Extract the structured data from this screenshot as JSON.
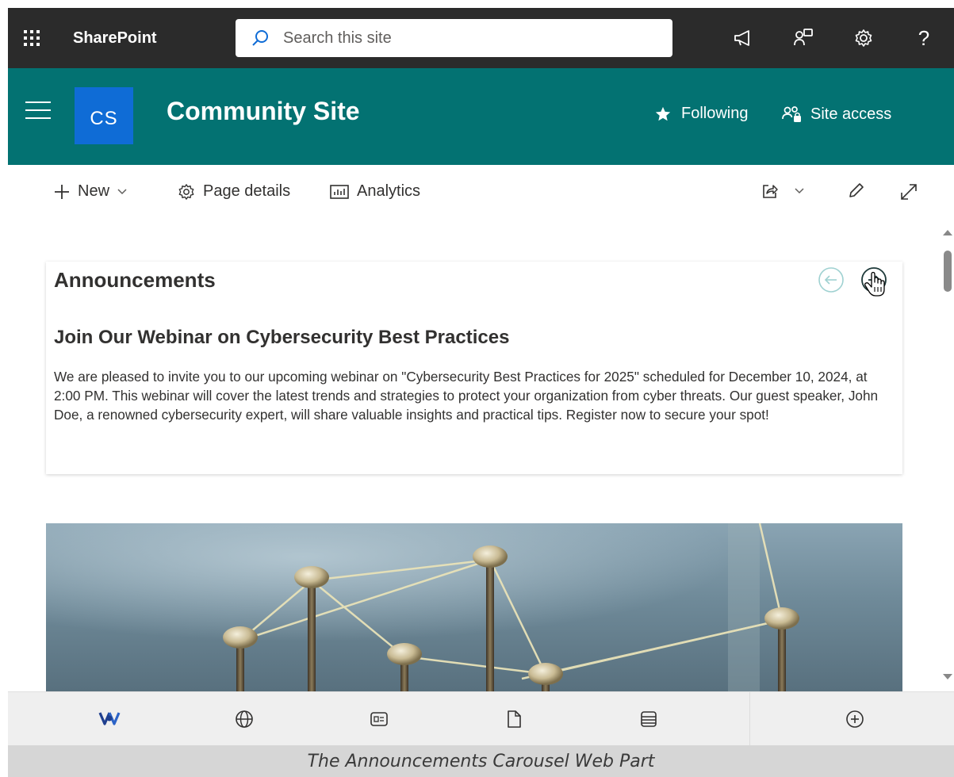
{
  "suitebar": {
    "app_name": "SharePoint",
    "search_placeholder": "Search this site",
    "help_label": "?"
  },
  "site": {
    "logo_text": "CS",
    "title": "Community Site",
    "following_label": "Following",
    "site_access_label": "Site access",
    "colors": {
      "header_bg": "#037272",
      "logo_bg": "#0f6cd6",
      "suitebar_bg": "#2b2b2b"
    }
  },
  "commandbar": {
    "new_label": "New",
    "page_details_label": "Page details",
    "analytics_label": "Analytics"
  },
  "announcements": {
    "title": "Announcements",
    "item": {
      "heading": "Join Our Webinar on Cybersecurity Best Practices",
      "body": "We are pleased to invite you to our upcoming webinar on \"Cybersecurity Best Practices for 2025\" scheduled for December 10, 2024, at 2:00 PM. This webinar will cover the latest trends and strategies to protect your organization from cyber threats. Our guest speaker, John Doe, a renowned cybersecurity expert, will share valuable insights and practical tips. Register now to secure your spot!"
    }
  },
  "bottombar": {
    "icons": [
      "viva-connections-icon",
      "globe-icon",
      "news-icon",
      "document-icon",
      "list-icon",
      "add-icon"
    ]
  },
  "caption": "The Announcements Carousel Web Part"
}
